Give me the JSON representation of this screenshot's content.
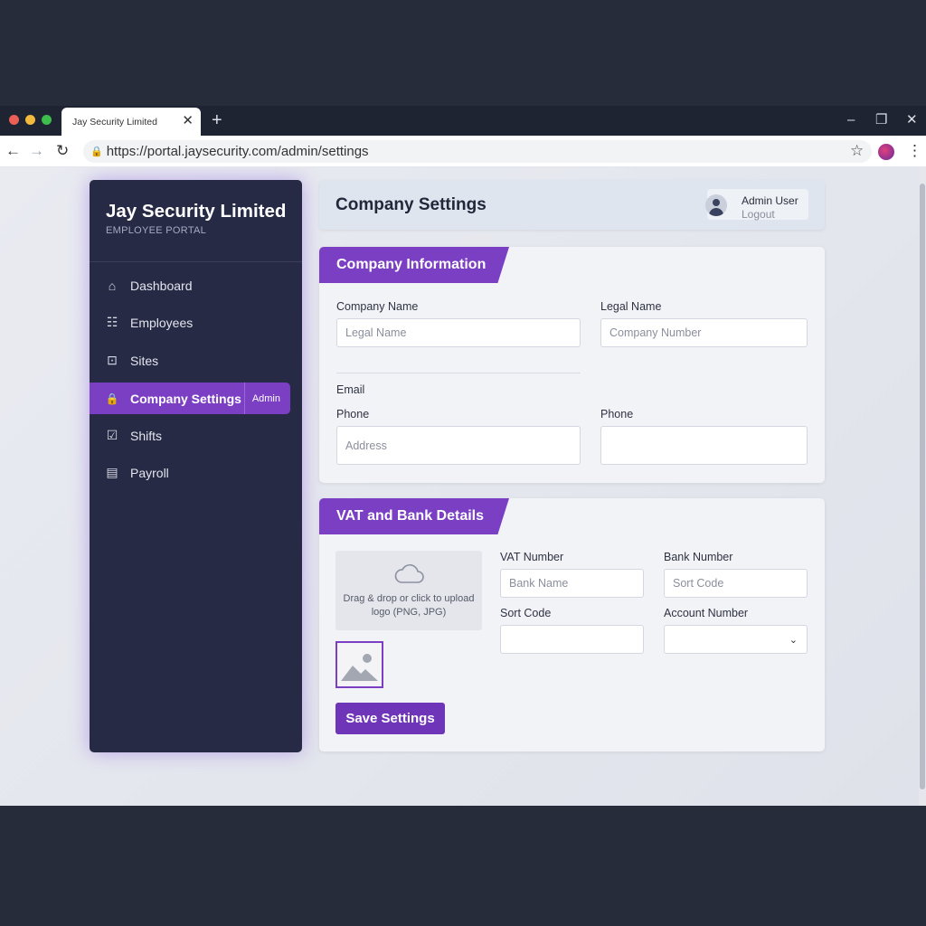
{
  "browser": {
    "tab_title": "Jay Security Limited",
    "tab_close": "✕",
    "new_tab": "+",
    "url": "https://portal.jaysecurity.com/admin/settings",
    "window_controls": {
      "minimize": "–",
      "restore": "❐",
      "close": "✕"
    },
    "traffic_colors": [
      "#ec5f57",
      "#f2b93b",
      "#3cbd4c"
    ]
  },
  "sidebar": {
    "brand_title": "Jay Security Limited",
    "brand_subtitle": "EMPLOYEE PORTAL",
    "items": [
      {
        "label": "Dashboard",
        "icon": "home-icon",
        "glyph": "⌂"
      },
      {
        "label": "Employees",
        "icon": "employees-icon",
        "glyph": "☷"
      },
      {
        "label": "Sites",
        "icon": "sites-icon",
        "glyph": "⊡"
      },
      {
        "label": "Company Settings",
        "icon": "lock-icon",
        "glyph": "🔒",
        "active": true,
        "tag": "Admin"
      },
      {
        "label": "Shifts",
        "icon": "shifts-icon",
        "glyph": "☑"
      },
      {
        "label": "Payroll",
        "icon": "payroll-icon",
        "glyph": "▤"
      }
    ]
  },
  "header": {
    "title": "Company Settings",
    "user_name": "Admin User",
    "logout": "Logout"
  },
  "company_info": {
    "heading": "Company Information",
    "company_name_label": "Company Name",
    "company_name_placeholder": "Legal Name",
    "legal_name_label": "Legal Name",
    "legal_name_placeholder": "Company Number",
    "email_label": "Email",
    "phone_label_left": "Phone",
    "phone_placeholder_left": "Address",
    "phone_label_right": "Phone",
    "phone_placeholder_right": ""
  },
  "vat_bank": {
    "heading": "VAT and Bank Details",
    "upload_text_line1": "Drag & drop or click to upload",
    "upload_text_line2": "logo (PNG, JPG)",
    "vat_number_label": "VAT Number",
    "vat_number_placeholder": "Bank Name",
    "bank_number_label": "Bank Number",
    "bank_number_placeholder": "Sort Code",
    "sort_code_label": "Sort Code",
    "sort_code_value": "",
    "account_number_label": "Account Number",
    "account_number_value": "",
    "save_label": "Save Settings"
  },
  "colors": {
    "accent": "#7b3fc4",
    "sidebar_bg": "#262a44",
    "page_bg": "#272c3a"
  }
}
